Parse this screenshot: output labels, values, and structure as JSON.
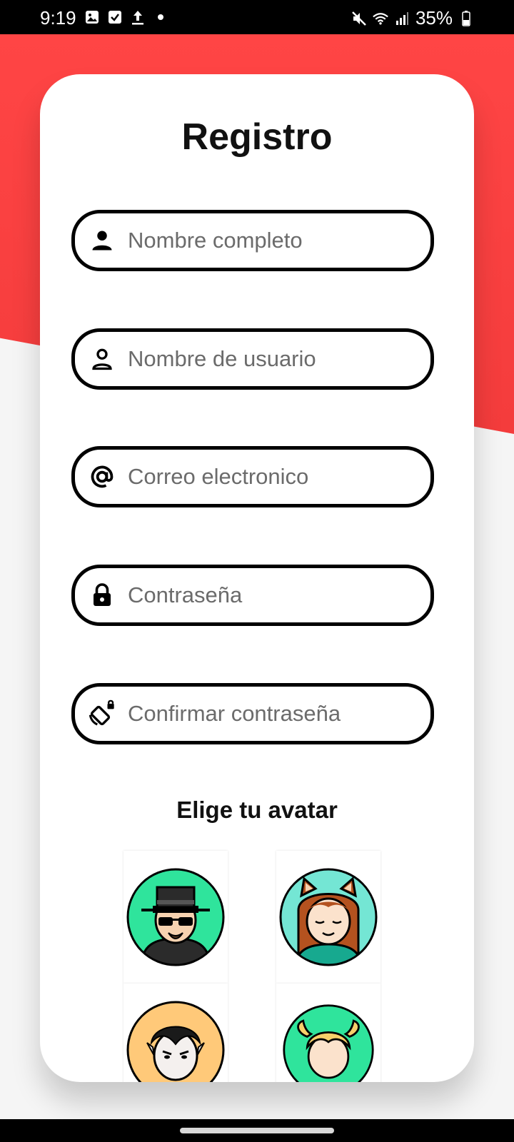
{
  "status_bar": {
    "time": "9:19",
    "battery": "35%",
    "icons_left": [
      "image-icon",
      "checkbox-icon",
      "upload-icon",
      "dot-icon"
    ],
    "icons_right": [
      "mute-icon",
      "wifi-icon",
      "signal-icon",
      "battery-icon"
    ]
  },
  "theme": {
    "accent": "#f43c3c",
    "card": "#ffffff",
    "border": "#000000"
  },
  "form": {
    "title": "Registro",
    "fields": [
      {
        "placeholder": "Nombre completo",
        "icon": "person-filled-icon"
      },
      {
        "placeholder": "Nombre de usuario",
        "icon": "person-outline-icon"
      },
      {
        "placeholder": "Correo electronico",
        "icon": "at-icon"
      },
      {
        "placeholder": "Contraseña",
        "icon": "lock-icon"
      },
      {
        "placeholder": "Confirmar contraseña",
        "icon": "screen-lock-rotation-icon"
      }
    ]
  },
  "avatars": {
    "title": "Elige tu avatar",
    "items": [
      {
        "name": "man-hat-sunglasses-avatar",
        "bg": "#2fe49c"
      },
      {
        "name": "girl-cat-ears-avatar",
        "bg": "#74e6d4"
      },
      {
        "name": "vampire-avatar",
        "bg": "#ffc979"
      },
      {
        "name": "blonde-girl-avatar",
        "bg": "#2fe49c"
      }
    ]
  }
}
